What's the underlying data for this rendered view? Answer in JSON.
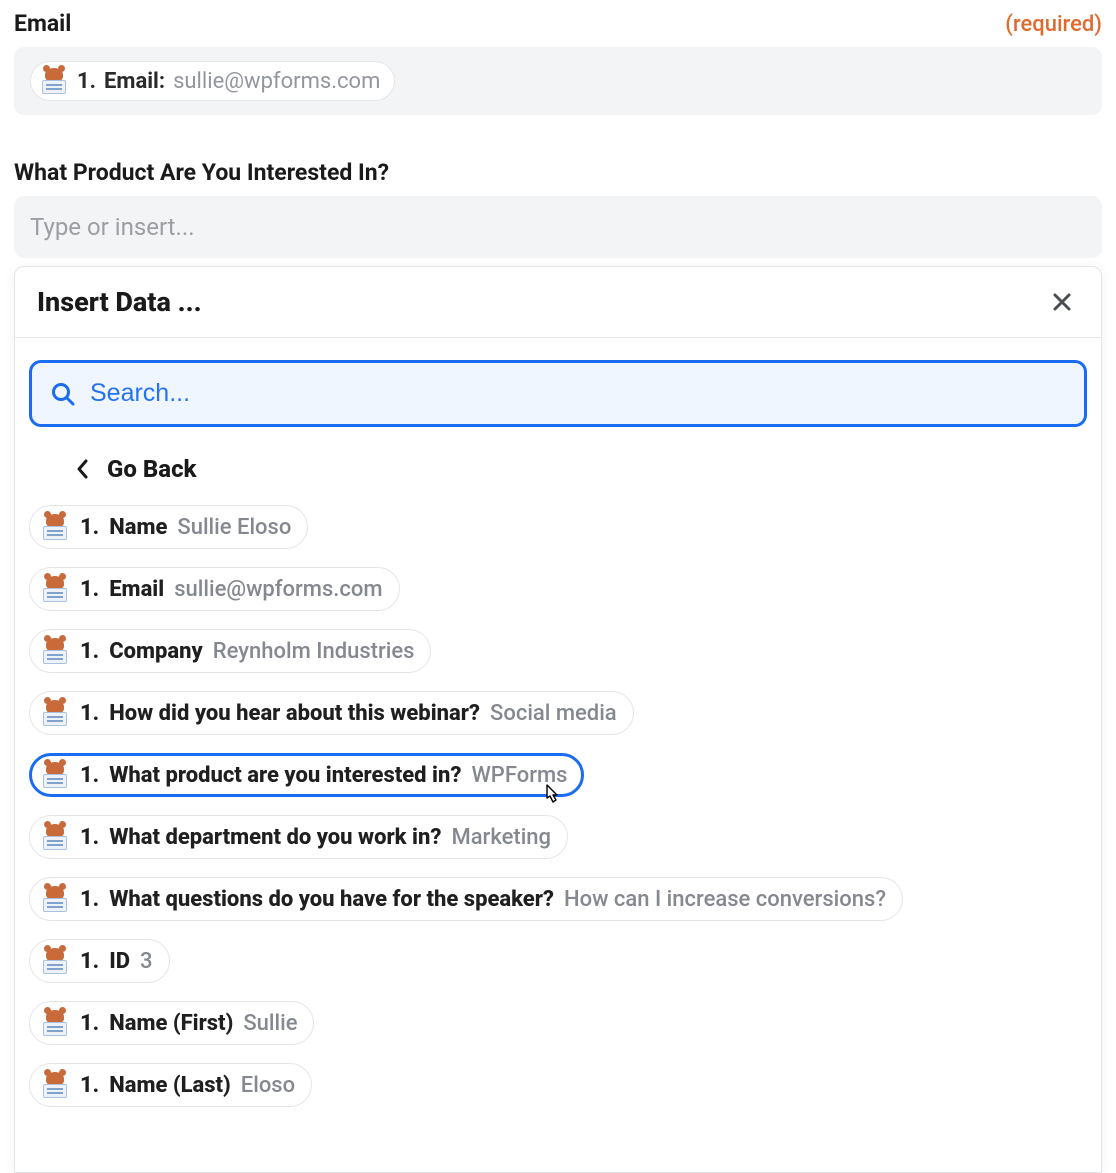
{
  "fields": {
    "email": {
      "label": "Email",
      "required_text": "(required)",
      "token_prefix": "1.",
      "token_label": "Email:",
      "token_value": "sullie@wpforms.com"
    },
    "product": {
      "label": "What Product Are You Interested In?",
      "placeholder": "Type or insert..."
    }
  },
  "modal": {
    "title": "Insert Data ...",
    "search_placeholder": "Search...",
    "go_back_label": "Go Back",
    "items": [
      {
        "prefix": "1.",
        "label": "Name",
        "value": "Sullie Eloso",
        "selected": false
      },
      {
        "prefix": "1.",
        "label": "Email",
        "value": "sullie@wpforms.com",
        "selected": false
      },
      {
        "prefix": "1.",
        "label": "Company",
        "value": "Reynholm Industries",
        "selected": false
      },
      {
        "prefix": "1.",
        "label": "How did you hear about this webinar?",
        "value": "Social media",
        "selected": false
      },
      {
        "prefix": "1.",
        "label": "What product are you interested in?",
        "value": "WPForms",
        "selected": true
      },
      {
        "prefix": "1.",
        "label": "What department do you work in?",
        "value": "Marketing",
        "selected": false
      },
      {
        "prefix": "1.",
        "label": "What questions do you have for the speaker?",
        "value": "How can I increase conversions?",
        "selected": false
      },
      {
        "prefix": "1.",
        "label": "ID",
        "value": "3",
        "selected": false
      },
      {
        "prefix": "1.",
        "label": "Name (First)",
        "value": "Sullie",
        "selected": false
      },
      {
        "prefix": "1.",
        "label": "Name (Last)",
        "value": "Eloso",
        "selected": false
      }
    ]
  }
}
